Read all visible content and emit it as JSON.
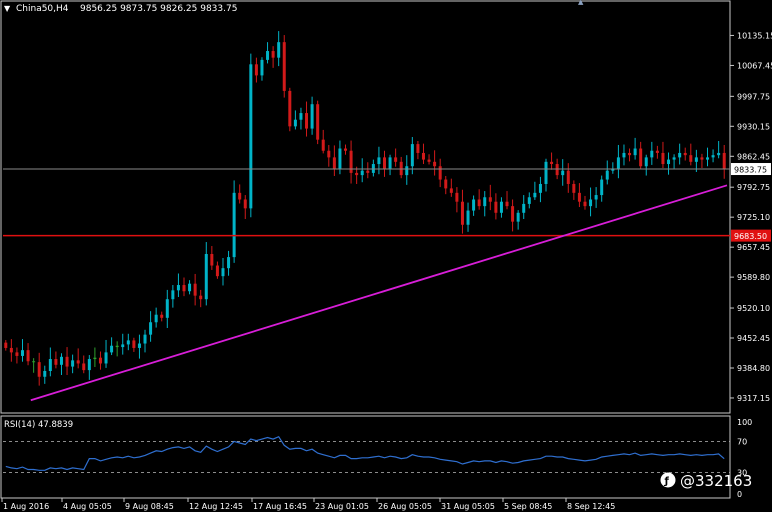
{
  "header": {
    "symbol_timeframe": "China50,H4",
    "ohlc": "9856.25 9873.75 9826.25 9833.75"
  },
  "watermark": "@332163",
  "colors": {
    "background": "#000000",
    "bull": "#00b4c8",
    "bear": "#d21a1a",
    "doji": "#2ea02e",
    "trendline": "#d81ed8",
    "hline": "#e01010",
    "rsi_line": "#2f6fd0",
    "grid_text": "#ffffff",
    "frame": "#c8c8c8"
  },
  "chart_data": [
    {
      "type": "candlestick",
      "panel": "main",
      "ylim": [
        9290,
        10170
      ],
      "y_ticks": [
        "10135.15",
        "10067.45",
        "9997.75",
        "9930.15",
        "9862.45",
        "9792.75",
        "9725.10",
        "9657.45",
        "9589.80",
        "9520.10",
        "9452.45",
        "9384.80",
        "9317.15"
      ],
      "x_ticks": [
        "1 Aug 2016",
        "4 Aug 05:05",
        "9 Aug 08:45",
        "12 Aug 12:45",
        "17 Aug 16:45",
        "23 Aug 01:05",
        "26 Aug 05:05",
        "31 Aug 05:05",
        "5 Sep 08:45",
        "8 Sep 12:45"
      ],
      "current_price": "9833.75",
      "hline_label": "9683.50",
      "hline_value": 9683.5,
      "trendline": [
        [
          0,
          9312
        ],
        [
          130,
          9797
        ]
      ],
      "closes": [
        9430,
        9420,
        9412,
        9425,
        9400,
        9398,
        9365,
        9378,
        9405,
        9392,
        9410,
        9388,
        9402,
        9395,
        9380,
        9405,
        9408,
        9395,
        9420,
        9435,
        9432,
        9438,
        9447,
        9430,
        9440,
        9460,
        9488,
        9505,
        9498,
        9540,
        9560,
        9572,
        9558,
        9575,
        9548,
        9540,
        9642,
        9616,
        9592,
        9610,
        9635,
        9780,
        9765,
        9745,
        10070,
        10045,
        10080,
        10100,
        10085,
        10120,
        10010,
        9930,
        9945,
        9960,
        9925,
        9980,
        9900,
        9875,
        9860,
        9835,
        9880,
        9875,
        9825,
        9820,
        9830,
        9825,
        9845,
        9860,
        9835,
        9860,
        9850,
        9820,
        9840,
        9890,
        9870,
        9855,
        9850,
        9840,
        9810,
        9790,
        9780,
        9760,
        9708,
        9740,
        9765,
        9750,
        9770,
        9760,
        9735,
        9760,
        9750,
        9715,
        9735,
        9755,
        9770,
        9780,
        9800,
        9850,
        9845,
        9820,
        9830,
        9800,
        9780,
        9760,
        9750,
        9765,
        9775,
        9810,
        9830,
        9835,
        9860,
        9870,
        9865,
        9880,
        9840,
        9860,
        9875,
        9870,
        9845,
        9855,
        9860,
        9870,
        9865,
        9850,
        9860,
        9855,
        9860,
        9865,
        9870,
        9833.75
      ]
    },
    {
      "type": "line",
      "panel": "rsi",
      "title": "RSI(14) 47.8839",
      "ylim": [
        0,
        100
      ],
      "y_ticks": [
        "100",
        "70",
        "30",
        "0"
      ],
      "levels": [
        70,
        30
      ],
      "values": [
        38,
        36,
        35,
        37,
        34,
        34,
        33,
        33,
        36,
        35,
        36,
        34,
        36,
        35,
        34,
        48,
        48,
        45,
        47,
        49,
        50,
        49,
        51,
        49,
        50,
        52,
        55,
        58,
        57,
        60,
        62,
        63,
        61,
        63,
        58,
        56,
        64,
        60,
        57,
        60,
        63,
        70,
        68,
        66,
        73,
        71,
        73,
        75,
        73,
        76,
        65,
        60,
        61,
        61,
        58,
        60,
        55,
        53,
        51,
        49,
        52,
        52,
        48,
        48,
        49,
        49,
        50,
        51,
        49,
        51,
        50,
        48,
        49,
        53,
        51,
        50,
        50,
        49,
        47,
        46,
        45,
        44,
        41,
        43,
        45,
        44,
        45,
        45,
        43,
        45,
        44,
        42,
        43,
        45,
        46,
        47,
        48,
        51,
        51,
        50,
        50,
        48,
        47,
        46,
        45,
        46,
        47,
        50,
        51,
        52,
        53,
        54,
        53,
        55,
        52,
        53,
        54,
        53,
        52,
        53,
        53,
        54,
        53,
        52,
        53,
        52,
        53,
        53,
        54,
        47.8839
      ]
    }
  ]
}
